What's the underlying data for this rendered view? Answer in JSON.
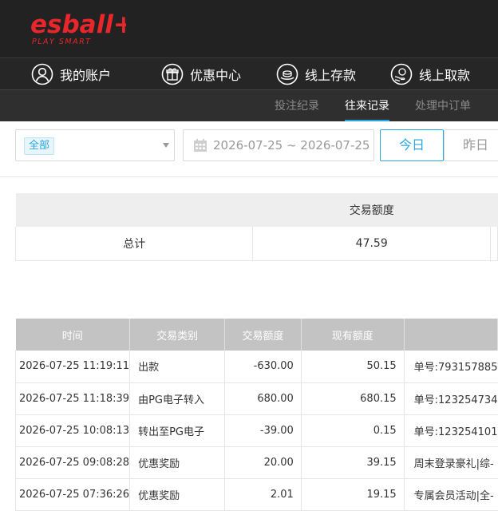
{
  "brand": {
    "logo_text": "esball+",
    "tagline": "PLAY SMART"
  },
  "main_nav": [
    {
      "label": "我的账户",
      "icon": "user-icon"
    },
    {
      "label": "优惠中心",
      "icon": "gift-icon"
    },
    {
      "label": "线上存款",
      "icon": "deposit-icon"
    },
    {
      "label": "线上取款",
      "icon": "withdraw-icon"
    }
  ],
  "sub_nav": [
    {
      "label": "投注纪录",
      "active": false
    },
    {
      "label": "往来记录",
      "active": true
    },
    {
      "label": "处理中订单",
      "active": false
    }
  ],
  "filters": {
    "type_select": "全部",
    "date_range": "2026-07-25 ~ 2026-07-25",
    "today_label": "今日",
    "yesterday_label": "昨日"
  },
  "summary": {
    "header": "交易额度",
    "label": "总计",
    "value": "47.59"
  },
  "records": {
    "columns": [
      "时间",
      "交易类别",
      "交易额度",
      "现有额度",
      ""
    ],
    "rows": [
      [
        "2026-07-25 11:19:11",
        "出款",
        "-630.00",
        "50.15",
        "单号:793157885"
      ],
      [
        "2026-07-25 11:18:39",
        "由PG电子转入",
        "680.00",
        "680.15",
        "单号:123254734"
      ],
      [
        "2026-07-25 10:08:13",
        "转出至PG电子",
        "-39.00",
        "0.15",
        "单号:123254101"
      ],
      [
        "2026-07-25 09:08:28",
        "优惠奖励",
        "20.00",
        "39.15",
        "周末登录豪礼|综-"
      ],
      [
        "2026-07-25 07:36:26",
        "优惠奖励",
        "2.01",
        "19.15",
        "专属会员活动|全-"
      ]
    ]
  },
  "colors": {
    "accent": "#29a8e0",
    "brand_red": "#e8262b",
    "topbar": "#222222"
  }
}
